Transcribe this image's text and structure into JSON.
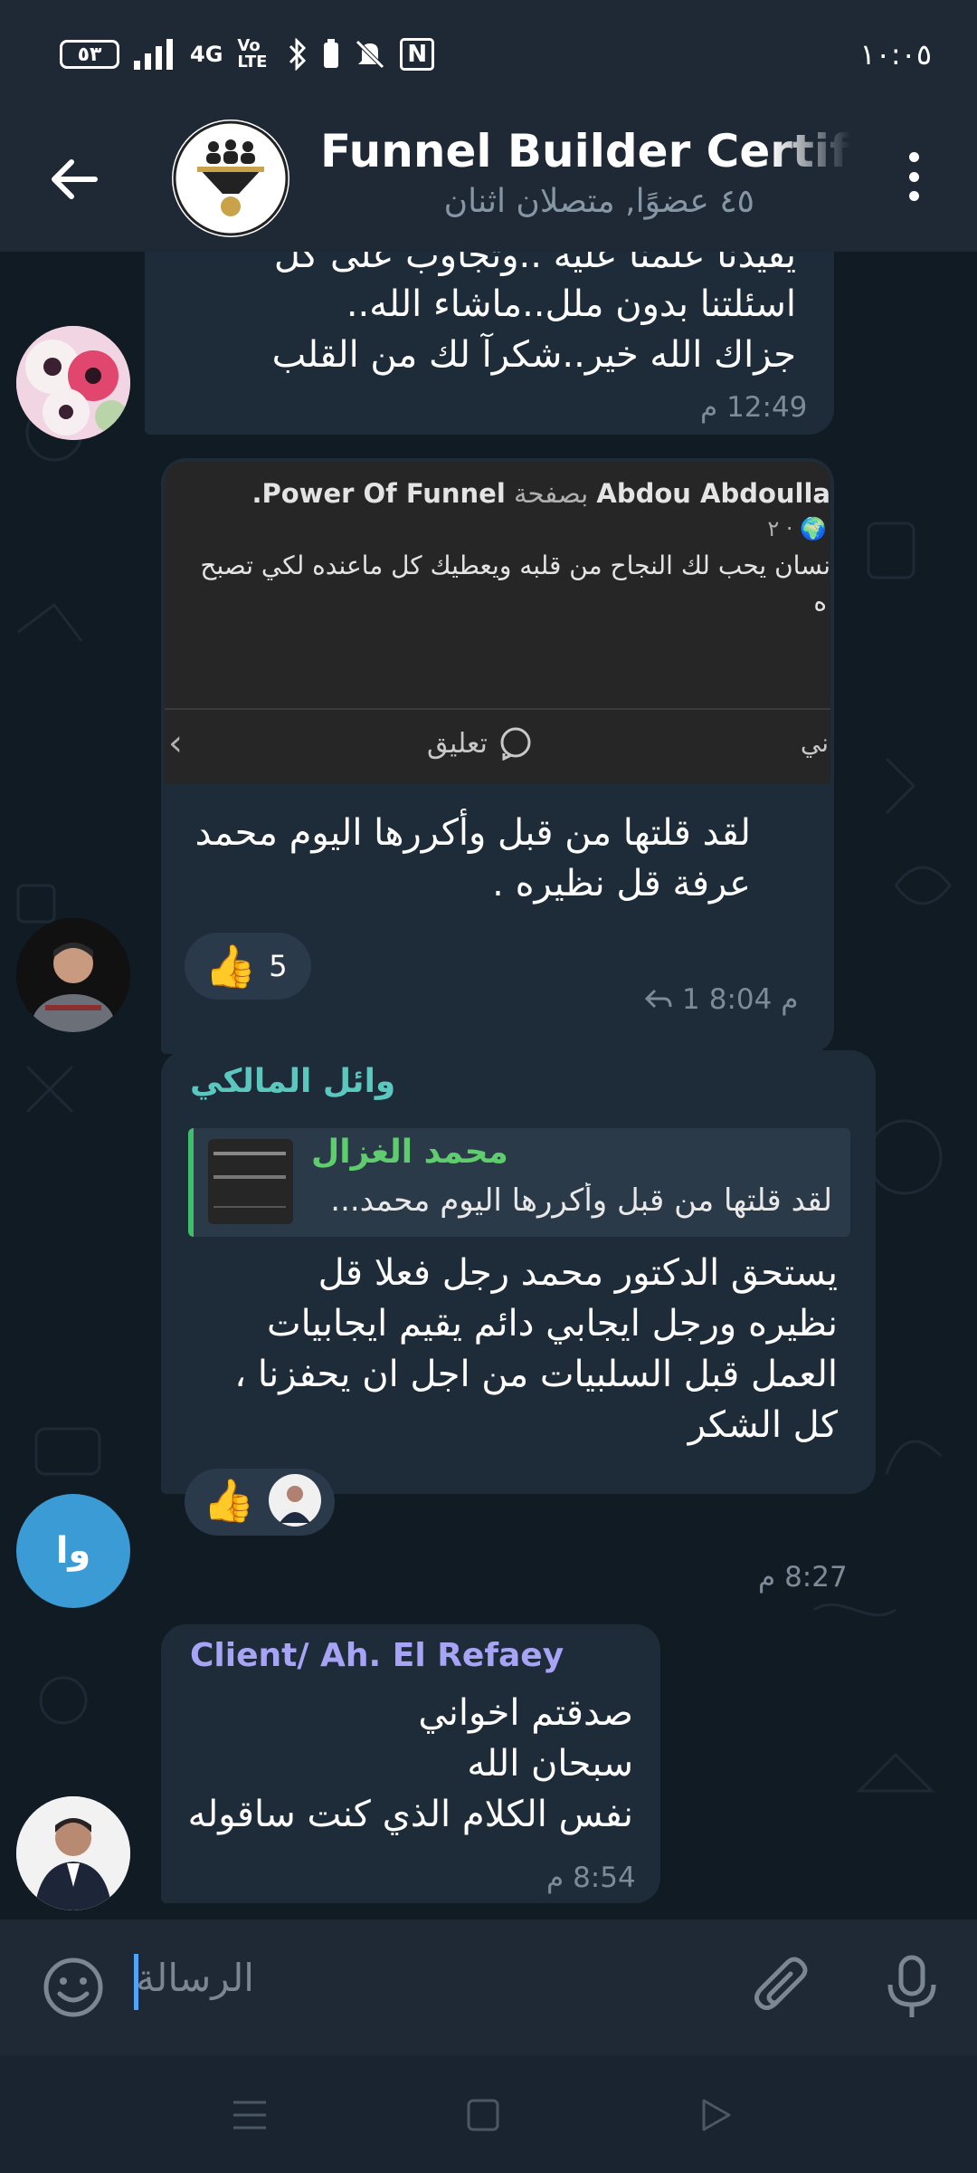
{
  "status_bar": {
    "battery": "٥٣",
    "network_4g": "4G",
    "volte": "Vo LTE",
    "nfc": "N",
    "time": "١٠:٠٥"
  },
  "header": {
    "title": "Funnel Builder Certificat",
    "subtitle": "٤٥ عضوًا, متصلان اثنان"
  },
  "messages": [
    {
      "text_partial": "يفيدنا علمنا عليه ..وتجاوب على كل",
      "text": "اسئلتنا بدون ملل..ماشاء الله..\nجزاك الله خير..شكرآ لك من القلب",
      "time": "12:49 م"
    },
    {
      "preview": {
        "title_en": "Abdou Abdoulla",
        "title_mid": "بصفحة",
        "title_page": "Power Of Funnel.",
        "meta": "٢ · 🌍",
        "body": "نسان يحب لك النجاح من قلبه ويعطيك كل ماعنده لكي تصبح",
        "body2": "ه",
        "comment": "تعليق",
        "side": "ني"
      },
      "text": "لقد قلتها من قبل وأكررها اليوم محمد\nعرفة قل نظيره .",
      "reaction_count": "5",
      "replies": "1",
      "time": "8:04 م"
    },
    {
      "sender": "وائل المالكي",
      "reply_to": {
        "name": "محمد الغزال",
        "text": "لقد قلتها من قبل وأكررها اليوم محمد..."
      },
      "text": "يستحق الدكتور محمد رجل فعلا قل\nنظيره ورجل ايجابي دائم يقيم ايجابيات\nالعمل قبل السلبيات من اجل ان يحفزنا ،\nكل الشكر",
      "avatar_initials": "وا",
      "time": "8:27 م"
    },
    {
      "sender": "Client/ Ah. El Refaey",
      "text": "صدقتم اخواني\nسبحان الله\nنفس الكلام الذي كنت ساقوله",
      "time": "8:54 م"
    }
  ],
  "input": {
    "placeholder": "الرسالة"
  },
  "colors": {
    "header_bg": "#1e2935",
    "chat_bg": "#111b24",
    "bubble_bg": "#1e2c3a",
    "sender_teal": "#5bc8c0",
    "sender_purple": "#a8a4f5",
    "reply_green": "#5fcd6e",
    "avatar_blue": "#3a9bd5"
  }
}
